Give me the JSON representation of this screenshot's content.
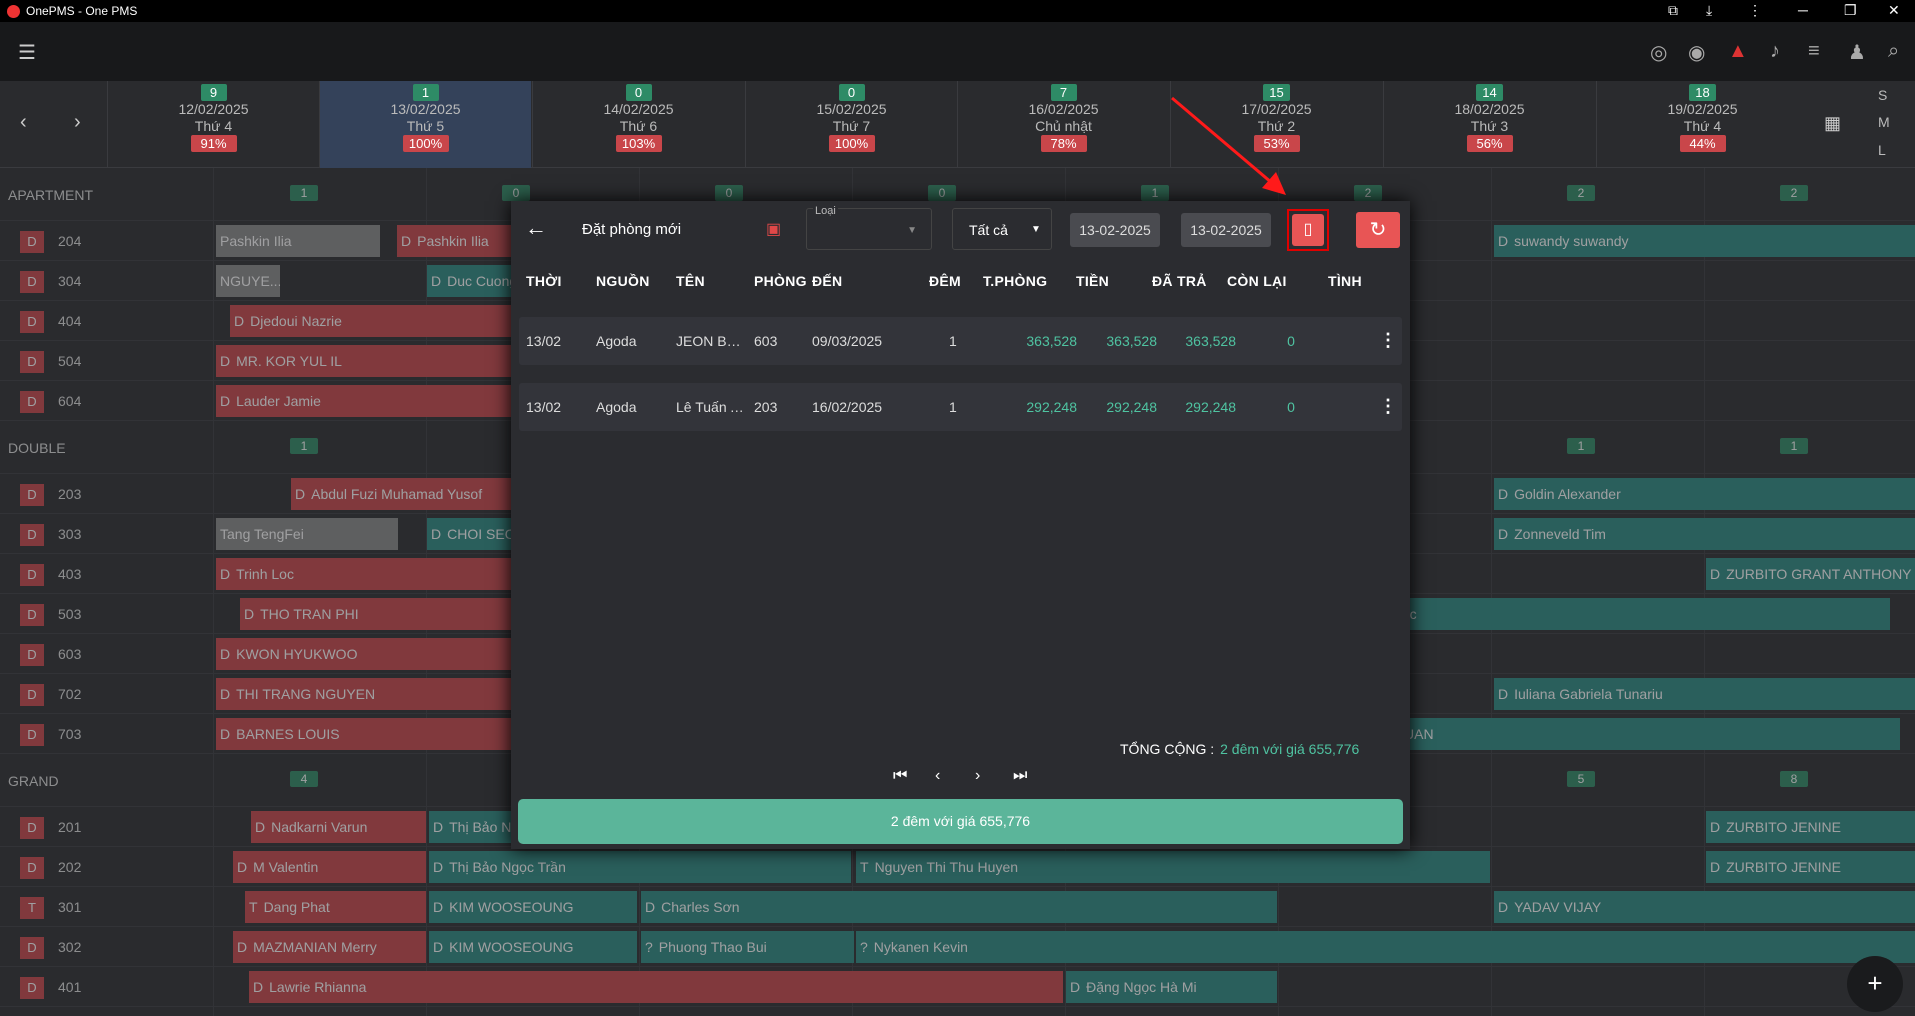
{
  "window": {
    "title": "OnePMS - One PMS"
  },
  "dates": [
    {
      "count": "9",
      "date": "12/02/2025",
      "day": "Thứ 4",
      "occ": "91%"
    },
    {
      "count": "1",
      "date": "13/02/2025",
      "day": "Thứ 5",
      "occ": "100%"
    },
    {
      "count": "0",
      "date": "14/02/2025",
      "day": "Thứ 6",
      "occ": "103%"
    },
    {
      "count": "0",
      "date": "15/02/2025",
      "day": "Thứ 7",
      "occ": "100%"
    },
    {
      "count": "7",
      "date": "16/02/2025",
      "day": "Chủ nhật",
      "occ": "78%"
    },
    {
      "count": "15",
      "date": "17/02/2025",
      "day": "Thứ 2",
      "occ": "53%"
    },
    {
      "count": "14",
      "date": "18/02/2025",
      "day": "Thứ 3",
      "occ": "56%"
    },
    {
      "count": "18",
      "date": "19/02/2025",
      "day": "Thứ 4",
      "occ": "44%"
    }
  ],
  "view_sizes": [
    "S",
    "M",
    "L"
  ],
  "categories": [
    {
      "name": "APARTMENT",
      "counts": [
        "1",
        "0",
        "0",
        "0",
        "1",
        "2",
        "2",
        "2"
      ]
    },
    {
      "name": "DOUBLE",
      "counts": [
        "1",
        "",
        "",
        "",
        "",
        "",
        "1",
        "1"
      ]
    },
    {
      "name": "GRAND",
      "counts": [
        "4",
        "",
        "",
        "",
        "",
        "",
        "5",
        "8"
      ]
    }
  ],
  "rooms": [
    {
      "status": "D",
      "number": "204",
      "bookings": [
        {
          "p": "",
          "name": "Pashkin Ilia",
          "c": "x"
        },
        {
          "p": "D",
          "name": "Pashkin Ilia",
          "c": "r"
        },
        {
          "p": "D",
          "name": "suwandy suwandy",
          "c": "g"
        }
      ]
    },
    {
      "status": "D",
      "number": "304",
      "bookings": [
        {
          "p": "",
          "name": "NGUYE...",
          "c": "x"
        },
        {
          "p": "D",
          "name": "Duc Cuong",
          "c": "g"
        }
      ]
    },
    {
      "status": "D",
      "number": "404",
      "bookings": [
        {
          "p": "D",
          "name": "Djedoui Nazrie",
          "c": "r"
        }
      ]
    },
    {
      "status": "D",
      "number": "504",
      "bookings": [
        {
          "p": "D",
          "name": "MR. KOR YUL IL",
          "c": "r"
        }
      ]
    },
    {
      "status": "D",
      "number": "604",
      "bookings": [
        {
          "p": "D",
          "name": "Lauder Jamie",
          "c": "r"
        }
      ]
    },
    {
      "status": "D",
      "number": "203",
      "bookings": [
        {
          "p": "D",
          "name": "Abdul Fuzi Muhamad Yusof",
          "c": "r"
        },
        {
          "p": "D",
          "name": "Goldin Alexander",
          "c": "g"
        }
      ]
    },
    {
      "status": "D",
      "number": "303",
      "bookings": [
        {
          "p": "",
          "name": "Tang TengFei",
          "c": "x"
        },
        {
          "p": "D",
          "name": "CHOI SEO",
          "c": "g"
        },
        {
          "p": "D",
          "name": "Zonneveld Tim",
          "c": "g"
        }
      ]
    },
    {
      "status": "D",
      "number": "403",
      "bookings": [
        {
          "p": "D",
          "name": "Trinh Loc",
          "c": "r"
        },
        {
          "p": "D",
          "name": "ZURBITO GRANT ANTHONY",
          "c": "g"
        }
      ]
    },
    {
      "status": "D",
      "number": "503",
      "bookings": [
        {
          "p": "D",
          "name": "THO TRAN PHI",
          "c": "r"
        },
        {
          "p": "",
          "name": "goc",
          "c": "g"
        }
      ]
    },
    {
      "status": "D",
      "number": "603",
      "bookings": [
        {
          "p": "D",
          "name": "KWON HYUKWOO",
          "c": "r"
        }
      ]
    },
    {
      "status": "D",
      "number": "702",
      "bookings": [
        {
          "p": "D",
          "name": "THI TRANG NGUYEN",
          "c": "r"
        },
        {
          "p": "D",
          "name": "Iuliana Gabriela Tunariu",
          "c": "g"
        }
      ]
    },
    {
      "status": "D",
      "number": "703",
      "bookings": [
        {
          "p": "D",
          "name": "BARNES LOUIS",
          "c": "r"
        },
        {
          "p": "",
          "name": "UAN",
          "c": "g"
        }
      ]
    },
    {
      "status": "D",
      "number": "201",
      "bookings": [
        {
          "p": "D",
          "name": "Nadkarni Varun",
          "c": "r"
        },
        {
          "p": "D",
          "name": "Thị Bảo N",
          "c": "g"
        },
        {
          "p": "D",
          "name": "ZURBITO JENINE",
          "c": "g"
        }
      ]
    },
    {
      "status": "D",
      "number": "202",
      "bookings": [
        {
          "p": "D",
          "name": "M Valentin",
          "c": "r"
        },
        {
          "p": "D",
          "name": "Thị Bảo Ngọc Trần",
          "c": "g"
        },
        {
          "p": "T",
          "name": "Nguyen Thi Thu Huyen",
          "c": "g"
        },
        {
          "p": "D",
          "name": "ZURBITO JENINE",
          "c": "g"
        }
      ]
    },
    {
      "status": "T",
      "number": "301",
      "bookings": [
        {
          "p": "T",
          "name": "Dang Phat",
          "c": "r"
        },
        {
          "p": "D",
          "name": "KIM WOOSEOUNG",
          "c": "g"
        },
        {
          "p": "D",
          "name": "Charles Sơn",
          "c": "g"
        },
        {
          "p": "D",
          "name": "YADAV VIJAY",
          "c": "g"
        }
      ]
    },
    {
      "status": "D",
      "number": "302",
      "bookings": [
        {
          "p": "D",
          "name": "MAZMANIAN Merry",
          "c": "r"
        },
        {
          "p": "D",
          "name": "KIM WOOSEOUNG",
          "c": "g"
        },
        {
          "p": "?",
          "name": "Phuong Thao Bui",
          "c": "g"
        },
        {
          "p": "?",
          "name": "Nykanen Kevin",
          "c": "g"
        }
      ]
    },
    {
      "status": "D",
      "number": "401",
      "bookings": [
        {
          "p": "D",
          "name": "Lawrie Rhianna",
          "c": "r"
        },
        {
          "p": "D",
          "name": "Đặng Ngọc Hà Mi",
          "c": "g"
        }
      ]
    }
  ],
  "dialog": {
    "title": "Đặt phòng mới",
    "type_label": "Loại",
    "filter_value": "Tất cả",
    "date_from": "13-02-2025",
    "date_to": "13-02-2025",
    "columns": [
      "THỜI",
      "NGUỒN",
      "TÊN",
      "PHÒNG",
      "ĐẾN",
      "ĐÊM",
      "T.PHÒNG",
      "TIỀN",
      "ĐÃ TRẢ",
      "CÒN LẠI",
      "TÌNH"
    ],
    "rows": [
      [
        "13/02",
        "Agoda",
        "JEON BYUNG",
        "603",
        "09/03/2025",
        "1",
        "363,528",
        "363,528",
        "363,528",
        "0"
      ],
      [
        "13/02",
        "Agoda",
        "Lê Tuấn Anh",
        "203",
        "16/02/2025",
        "1",
        "292,248",
        "292,248",
        "292,248",
        "0"
      ]
    ],
    "total_label": "TỔNG CỘNG :",
    "total_value": "2 đêm với giá 655,776",
    "confirm_label": "2 đêm với giá 655,776"
  }
}
